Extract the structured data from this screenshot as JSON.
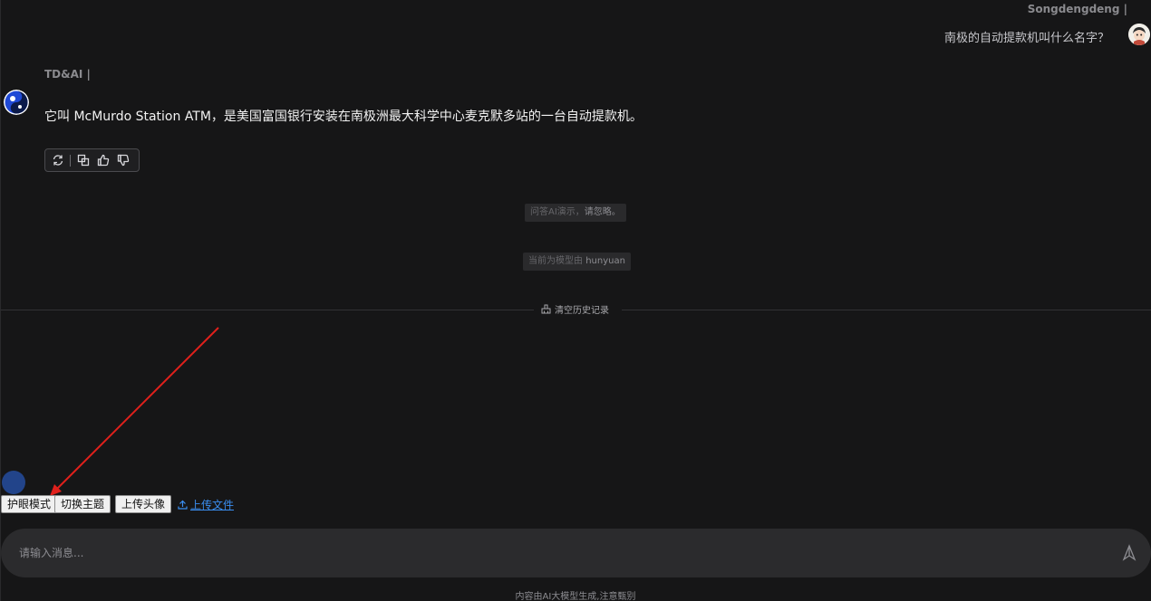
{
  "user": {
    "name": "Songdengdeng  |",
    "message": "南极的自动提款机叫什么名字？"
  },
  "ai": {
    "name": "TD&AI  |",
    "message": "它叫 McMurdo Station ATM，是美国富国银行安装在南极洲最大科学中心麦克默多站的一台自动提款机。",
    "toolbar_icons": [
      "refresh-icon",
      "copy-icon",
      "thumbs-up-icon",
      "thumbs-down-icon"
    ]
  },
  "notices": {
    "demo_prefix": "问答AI演示，",
    "demo_suffix": "请忽略。",
    "model_prefix": "当前为模型由 ",
    "model_name": "hunyuan"
  },
  "clear_history": "清空历史记录",
  "buttons": {
    "eye_care": "护眼模式",
    "switch_theme": "切换主题",
    "upload_avatar": "上传头像",
    "upload_file": "上传文件"
  },
  "input": {
    "placeholder": "请输入消息..."
  },
  "footer": "内容由AI大模型生成,注意甄别",
  "colors": {
    "background": "#161617",
    "link": "#3a8ef0",
    "annotation_arrow": "#e0201c",
    "annotation_circle": "#22448a"
  }
}
